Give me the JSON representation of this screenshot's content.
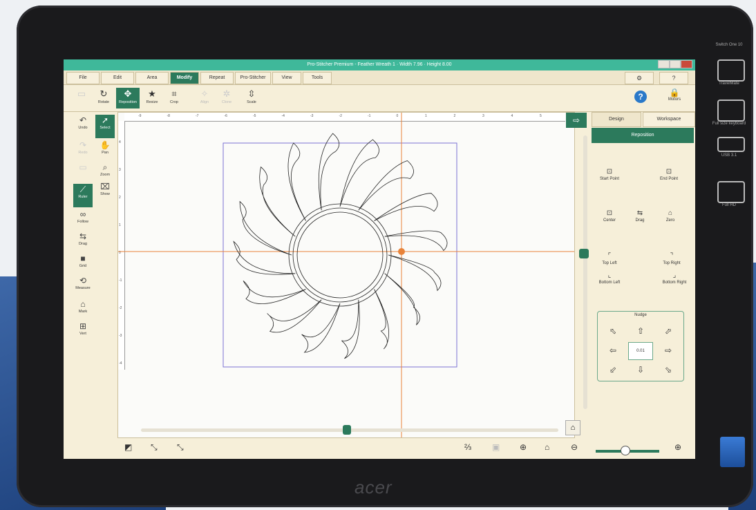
{
  "window": {
    "title": "Pro-Stitcher Premium  -  Feather Wreath 1 · Width 7.96 · Height 8.00"
  },
  "menu": {
    "tabs": [
      "File",
      "Edit",
      "Area",
      "Modify",
      "Repeat",
      "Pro-Stitcher",
      "View",
      "Tools"
    ],
    "active": "Modify",
    "gear": "⚙",
    "help": "?"
  },
  "toolbar": {
    "items": [
      {
        "label": "Rotate",
        "icon": "rotate-icon"
      },
      {
        "label": "Reposition",
        "icon": "reposition-icon"
      },
      {
        "label": "Resize",
        "icon": "resize-icon"
      },
      {
        "label": "Crop",
        "icon": "crop-icon"
      },
      {
        "label": "Align",
        "icon": "align-icon"
      },
      {
        "label": "Clone",
        "icon": "clone-icon"
      },
      {
        "label": "Scale",
        "icon": "scale-icon"
      }
    ],
    "motors_label": "Motors"
  },
  "left_tools": [
    {
      "label": "Undo",
      "icon": "undo-icon"
    },
    {
      "label": "Select",
      "icon": "select-icon"
    },
    {
      "label": "Redo",
      "icon": "redo-icon"
    },
    {
      "label": "Pan",
      "icon": "pan-icon"
    },
    {
      "label": "Zoom",
      "icon": "zoom-icon"
    },
    {
      "label": "Show",
      "icon": "show-icon"
    },
    {
      "label": "Ruler",
      "icon": "ruler-icon"
    },
    {
      "label": "Follow",
      "icon": "follow-icon"
    },
    {
      "label": "Drag",
      "icon": "drag-icon"
    },
    {
      "label": "Grid",
      "icon": "grid-icon"
    },
    {
      "label": "Measure",
      "icon": "measure-icon"
    },
    {
      "label": "Mark",
      "icon": "mark-icon"
    },
    {
      "label": "Vert",
      "icon": "vert-icon"
    }
  ],
  "ruler": {
    "top_ticks": [
      "-9",
      "-8",
      "-7",
      "-6",
      "-5",
      "-4",
      "-3",
      "-2",
      "-1",
      "0",
      "1",
      "2",
      "3",
      "4",
      "5"
    ],
    "left_ticks": [
      "4",
      "3",
      "2",
      "1",
      "0",
      "-1",
      "-2",
      "-3",
      "-4"
    ]
  },
  "right_panel": {
    "tabs": [
      "Design",
      "Workspace"
    ],
    "active_tab": "Design",
    "header": "Reposition",
    "positions": [
      "Start Point",
      "End Point",
      "Center",
      "Drag",
      "Zero",
      "Top Left",
      "Top Right",
      "Bottom Left",
      "Bottom Right"
    ],
    "nudge_title": "Nudge",
    "nudge_value": "0.01"
  },
  "device": {
    "brand": "acer",
    "side_labels": [
      "Switch One 10",
      "TravelMate",
      "Full size keyboard",
      "USB 3.1",
      "Full HD"
    ]
  }
}
